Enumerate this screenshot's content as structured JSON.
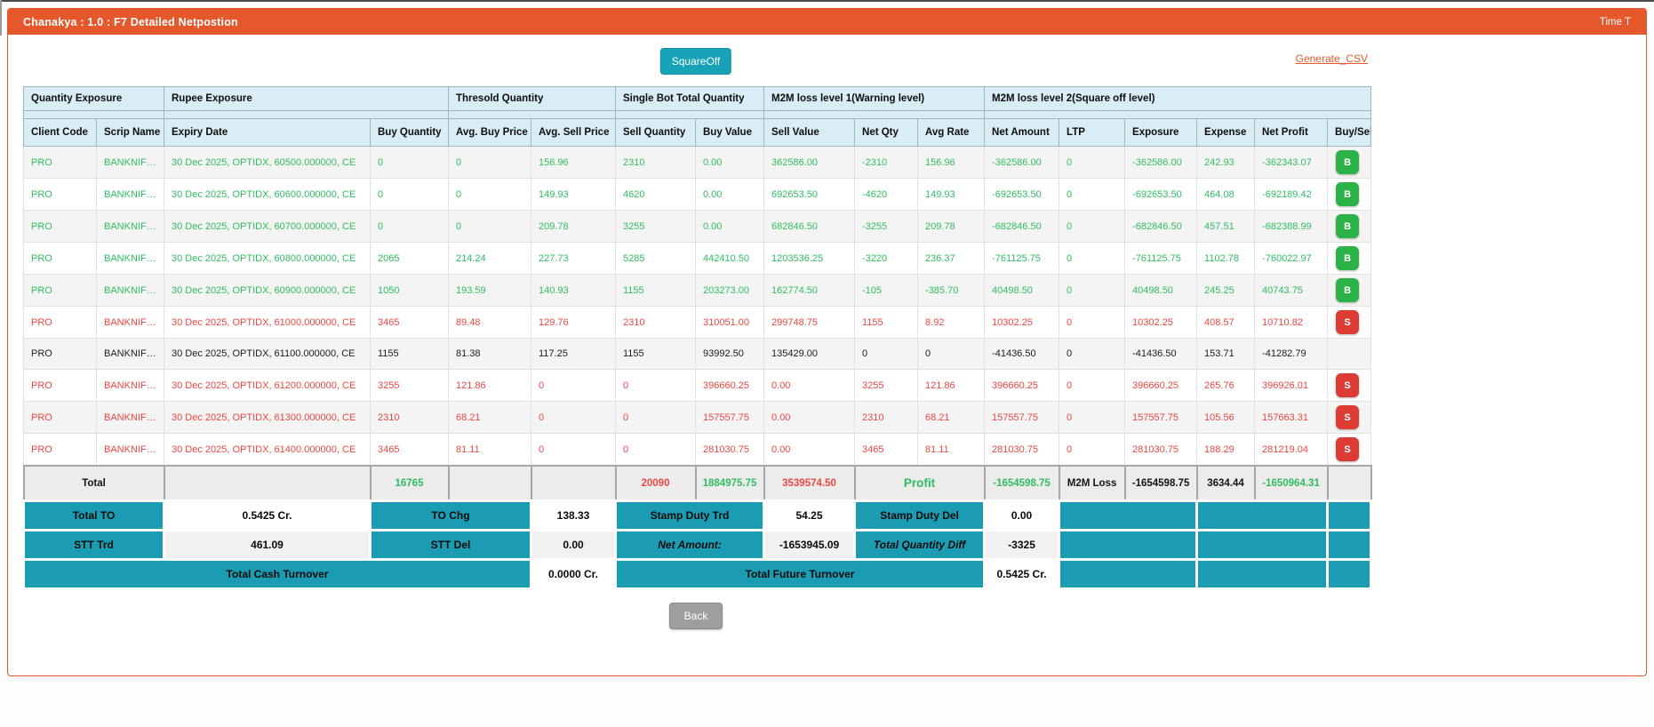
{
  "window": {
    "title": "Chanakya : 1.0 : F7 Detailed Netpostion",
    "time_label": "Time T"
  },
  "toolbar": {
    "squareoff_label": "SquareOff",
    "generate_csv_label": "Generate_CSV",
    "back_label": "Back"
  },
  "colors": {
    "accent_orange": "#e4582c",
    "header_blue": "#d8edf4",
    "teal": "#1b9cb3",
    "green": "#2fbd5f",
    "red": "#ef4641",
    "buy_button_green": "#2bb34a",
    "sell_button_red": "#dc3c33",
    "squareoff_teal": "#17a2b8"
  },
  "table": {
    "group_headers": [
      {
        "label": "Quantity Exposure",
        "span": 2
      },
      {
        "label": "Rupee Exposure",
        "span": 2
      },
      {
        "label": "Thresold Quantity",
        "span": 2
      },
      {
        "label": "Single Bot Total Quantity",
        "span": 2
      },
      {
        "label": "M2M loss level 1(Warning level)",
        "span": 3
      },
      {
        "label": "M2M loss level 2(Square off level)",
        "span": 6
      }
    ],
    "columns": [
      "Client Code",
      "Scrip Name",
      "Expiry Date",
      "Buy Quantity",
      "Avg. Buy Price",
      "Avg. Sell Price",
      "Sell Quantity",
      "Buy Value",
      "Sell Value",
      "Net Qty",
      "Avg Rate",
      "Net Amount",
      "LTP",
      "Exposure",
      "Expense",
      "Net Profit",
      "Buy/Sell"
    ],
    "rows": [
      {
        "tone": "green",
        "action": "B",
        "cells": [
          "PRO",
          "BANKNIFTY",
          "30 Dec 2025, OPTIDX, 60500.000000, CE",
          "0",
          "0",
          "156.96",
          "2310",
          "0.00",
          "362586.00",
          "-2310",
          "156.96",
          "-362586.00",
          "0",
          "-362586.00",
          "242.93",
          "-362343.07"
        ]
      },
      {
        "tone": "green",
        "action": "B",
        "cells": [
          "PRO",
          "BANKNIFTY",
          "30 Dec 2025, OPTIDX, 60600.000000, CE",
          "0",
          "0",
          "149.93",
          "4620",
          "0.00",
          "692653.50",
          "-4620",
          "149.93",
          "-692653.50",
          "0",
          "-692653.50",
          "464.08",
          "-692189.42"
        ]
      },
      {
        "tone": "green",
        "action": "B",
        "cells": [
          "PRO",
          "BANKNIFTY",
          "30 Dec 2025, OPTIDX, 60700.000000, CE",
          "0",
          "0",
          "209.78",
          "3255",
          "0.00",
          "682846.50",
          "-3255",
          "209.78",
          "-682846.50",
          "0",
          "-682846.50",
          "457.51",
          "-682388.99"
        ]
      },
      {
        "tone": "green",
        "action": "B",
        "cells": [
          "PRO",
          "BANKNIFTY",
          "30 Dec 2025, OPTIDX, 60800.000000, CE",
          "2065",
          "214.24",
          "227.73",
          "5285",
          "442410.50",
          "1203536.25",
          "-3220",
          "236.37",
          "-761125.75",
          "0",
          "-761125.75",
          "1102.78",
          "-760022.97"
        ]
      },
      {
        "tone": "green",
        "action": "B",
        "cells": [
          "PRO",
          "BANKNIFTY",
          "30 Dec 2025, OPTIDX, 60900.000000, CE",
          "1050",
          "193.59",
          "140.93",
          "1155",
          "203273.00",
          "162774.50",
          "-105",
          "-385.70",
          "40498.50",
          "0",
          "40498.50",
          "245.25",
          "40743.75"
        ]
      },
      {
        "tone": "red",
        "action": "S",
        "cells": [
          "PRO",
          "BANKNIFTY",
          "30 Dec 2025, OPTIDX, 61000.000000, CE",
          "3465",
          "89.48",
          "129.76",
          "2310",
          "310051.00",
          "299748.75",
          "1155",
          "8.92",
          "10302.25",
          "0",
          "10302.25",
          "408.57",
          "10710.82"
        ]
      },
      {
        "tone": "black",
        "action": null,
        "cells": [
          "PRO",
          "BANKNIFTY",
          "30 Dec 2025, OPTIDX, 61100.000000, CE",
          "1155",
          "81.38",
          "117.25",
          "1155",
          "93992.50",
          "135429.00",
          "0",
          "0",
          "-41436.50",
          "0",
          "-41436.50",
          "153.71",
          "-41282.79"
        ]
      },
      {
        "tone": "red",
        "action": "S",
        "cells": [
          "PRO",
          "BANKNIFTY",
          "30 Dec 2025, OPTIDX, 61200.000000, CE",
          "3255",
          "121.86",
          "0",
          "0",
          "396660.25",
          "0.00",
          "3255",
          "121.86",
          "396660.25",
          "0",
          "396660.25",
          "265.76",
          "396926.01"
        ]
      },
      {
        "tone": "red",
        "action": "S",
        "cells": [
          "PRO",
          "BANKNIFTY",
          "30 Dec 2025, OPTIDX, 61300.000000, CE",
          "2310",
          "68.21",
          "0",
          "0",
          "157557.75",
          "0.00",
          "2310",
          "68.21",
          "157557.75",
          "0",
          "157557.75",
          "105.56",
          "157663.31"
        ]
      },
      {
        "tone": "red",
        "action": "S",
        "cells": [
          "PRO",
          "BANKNIFTY",
          "30 Dec 2025, OPTIDX, 61400.000000, CE",
          "3465",
          "81.11",
          "0",
          "0",
          "281030.75",
          "0.00",
          "3465",
          "81.11",
          "281030.75",
          "0",
          "281030.75",
          "188.29",
          "281219.04"
        ]
      }
    ],
    "total": {
      "label": "Total",
      "buy_qty": "16765",
      "sell_qty": "20090",
      "buy_value": "1884975.75",
      "sell_value": "3539574.50",
      "profit_label": "Profit",
      "net_amount": "-1654598.75",
      "m2m_loss_label": "M2M Loss",
      "exposure": "-1654598.75",
      "expense": "3634.44",
      "net_profit": "-1650964.31"
    }
  },
  "summary": {
    "row1": [
      {
        "label": "Total TO",
        "value": "0.5425 Cr."
      },
      {
        "label": "TO Chg",
        "value": "138.33"
      },
      {
        "label": "Stamp Duty Trd",
        "value": "54.25"
      },
      {
        "label": "Stamp Duty Del",
        "value": "0.00"
      }
    ],
    "row2": [
      {
        "label": "STT Trd",
        "value": "461.09"
      },
      {
        "label": "STT Del",
        "value": "0.00"
      },
      {
        "label": "Net Amount:",
        "value": "-1653945.09"
      },
      {
        "label": "Total Quantity Diff",
        "value": "-3325"
      }
    ],
    "row3": [
      {
        "label": "Total Cash Turnover",
        "value": "0.0000 Cr."
      },
      {
        "label": "Total Future Turnover",
        "value": "0.5425 Cr."
      }
    ]
  }
}
